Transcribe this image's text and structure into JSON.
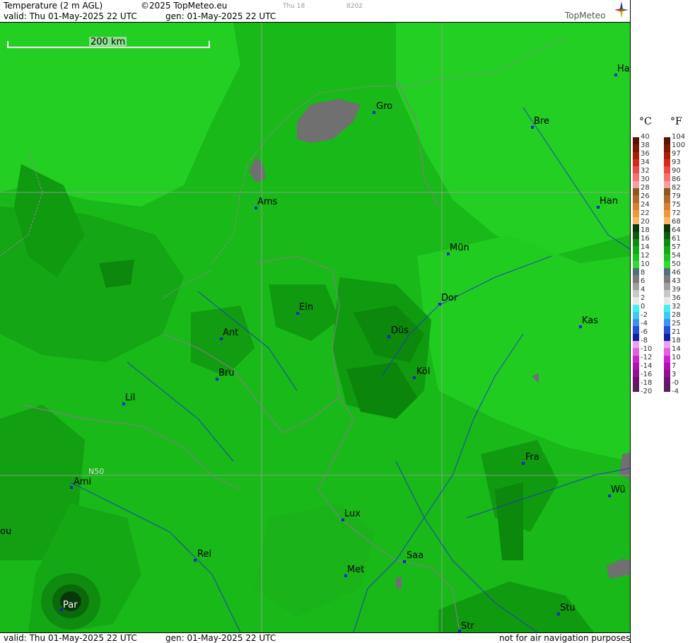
{
  "header": {
    "title": "Temperature (2 m AGL)",
    "copyright": "©2025 TopMeteo.eu",
    "valid": "valid:  Thu  01-May-2025  22 UTC",
    "gen": "gen: 01-May-2025 22 UTC",
    "day_code": "Thu 18",
    "code2": "8202",
    "logo_text": "TopMeteo"
  },
  "map": {
    "scale_label": "200 km",
    "lat_label": "N50",
    "cities": [
      {
        "name": "Gro"
      },
      {
        "name": "Bre"
      },
      {
        "name": "Ha"
      },
      {
        "name": "Ams"
      },
      {
        "name": "Han"
      },
      {
        "name": "Mün"
      },
      {
        "name": "Ein"
      },
      {
        "name": "Dor"
      },
      {
        "name": "Ant"
      },
      {
        "name": "Düs"
      },
      {
        "name": "Kas"
      },
      {
        "name": "Köl"
      },
      {
        "name": "Bru"
      },
      {
        "name": "Lil"
      },
      {
        "name": "Fra"
      },
      {
        "name": "Ami"
      },
      {
        "name": "Wü"
      },
      {
        "name": "Lux"
      },
      {
        "name": "ou"
      },
      {
        "name": "Rei"
      },
      {
        "name": "Saa"
      },
      {
        "name": "Met"
      },
      {
        "name": "Par"
      },
      {
        "name": "Stu"
      },
      {
        "name": "Str"
      }
    ]
  },
  "footer": {
    "valid": "valid:  Thu  01-May-2025  22 UTC",
    "gen": "gen: 01-May-2025 22 UTC",
    "note": "not for air navigation purposes"
  },
  "legend": {
    "c_unit": "°C",
    "f_unit": "°F",
    "c_ticks": [
      "40",
      "38",
      "36",
      "34",
      "32",
      "30",
      "28",
      "26",
      "24",
      "22",
      "20",
      "18",
      "16",
      "14",
      "12",
      "10",
      "8",
      "6",
      "4",
      "2",
      "0",
      "-2",
      "-4",
      "-6",
      "-8",
      "-10",
      "-12",
      "-14",
      "-16",
      "-18",
      "-20"
    ],
    "f_ticks": [
      "104",
      "100",
      "97",
      "93",
      "90",
      "86",
      "82",
      "79",
      "75",
      "72",
      "68",
      "64",
      "61",
      "57",
      "54",
      "50",
      "46",
      "43",
      "39",
      "36",
      "32",
      "28",
      "25",
      "21",
      "18",
      "14",
      "10",
      "7",
      "3",
      "-0",
      "-4"
    ],
    "colors": [
      "#5a1000",
      "#7a1a00",
      "#a82000",
      "#d82818",
      "#f04848",
      "#f87070",
      "#f8a0a0",
      "#8a5a20",
      "#b06a28",
      "#d88030",
      "#f09838",
      "#f8b868",
      "#0a3a0a",
      "#0e5a0e",
      "#108a10",
      "#14aa14",
      "#1cc41c",
      "#30dc30",
      "#50707a",
      "#7c7c7c",
      "#a0a0a0",
      "#c8c8c8",
      "#e8e8e8",
      "#40f0f0",
      "#40c8f0",
      "#4090f0",
      "#2050d8",
      "#1020a0",
      "#f0a0f0",
      "#e060e0",
      "#d020d0",
      "#b010b0",
      "#901090",
      "#701070",
      "#582058"
    ]
  }
}
